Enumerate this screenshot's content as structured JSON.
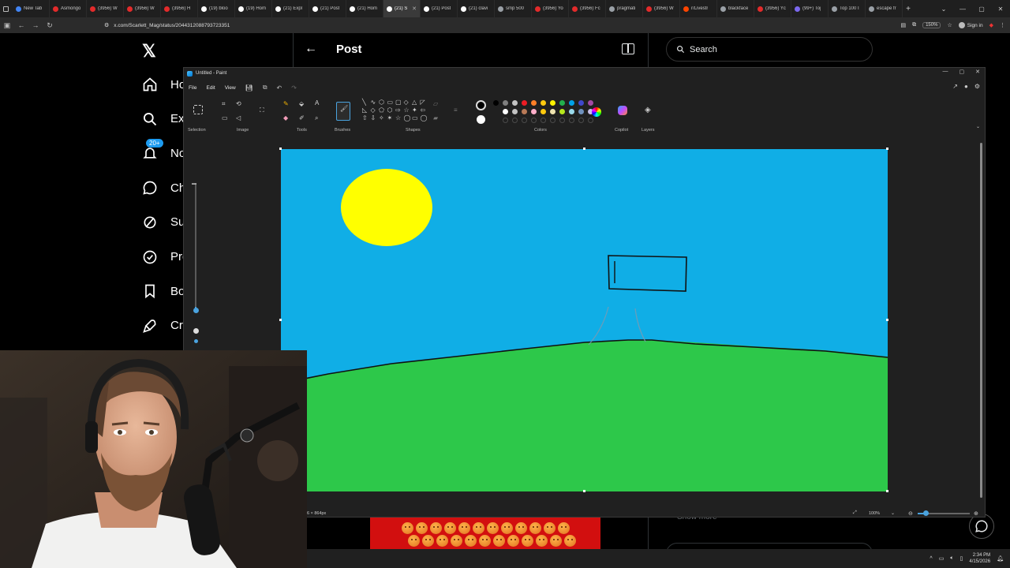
{
  "browser": {
    "tabs": [
      {
        "label": "New Tab",
        "color": "#4285f4"
      },
      {
        "label": "Asmongo",
        "color": "#e32b2b"
      },
      {
        "label": "(3956) W",
        "color": "#e32b2b"
      },
      {
        "label": "(3956) W",
        "color": "#e32b2b"
      },
      {
        "label": "(3956) H",
        "color": "#e32b2b"
      },
      {
        "label": "(19) bloo",
        "color": "#ffffff"
      },
      {
        "label": "(19) Hom",
        "color": "#ffffff"
      },
      {
        "label": "(21) Expl",
        "color": "#ffffff"
      },
      {
        "label": "(21) Post",
        "color": "#ffffff"
      },
      {
        "label": "(21) Hom",
        "color": "#ffffff"
      },
      {
        "label": "(21) S",
        "color": "#ffffff",
        "active": true
      },
      {
        "label": "(21) Post",
        "color": "#ffffff"
      },
      {
        "label": "(21) clavi",
        "color": "#ffffff"
      },
      {
        "label": "smp 500",
        "color": "#9aa0a6"
      },
      {
        "label": "(3956) Yo",
        "color": "#e32b2b"
      },
      {
        "label": "(3956) Fc",
        "color": "#e32b2b"
      },
      {
        "label": "pragmati",
        "color": "#9aa0a6"
      },
      {
        "label": "(3956) W",
        "color": "#e32b2b"
      },
      {
        "label": "r/Livestr",
        "color": "#ff4500"
      },
      {
        "label": "blackface",
        "color": "#9aa0a6"
      },
      {
        "label": "(3956) Yc",
        "color": "#e32b2b"
      },
      {
        "label": "(99+) Toj",
        "color": "#7b68ee"
      },
      {
        "label": "Top 100 I",
        "color": "#9aa0a6"
      },
      {
        "label": "escape fr",
        "color": "#9aa0a6"
      }
    ],
    "url": "x.com/Scarlett_Mag/status/2044312088793723351",
    "zoom": "150%",
    "signin_label": "Sign in"
  },
  "x": {
    "nav": [
      {
        "label": "Ho",
        "icon": "home-icon"
      },
      {
        "label": "Ex",
        "icon": "search-icon"
      },
      {
        "label": "No",
        "icon": "bell-icon",
        "badge": "20+"
      },
      {
        "label": "Ch",
        "icon": "chat-icon"
      },
      {
        "label": "Su",
        "icon": "slash-icon"
      },
      {
        "label": "Pre",
        "icon": "verified-icon"
      },
      {
        "label": "Bo",
        "icon": "bookmark-icon"
      },
      {
        "label": "Cr",
        "icon": "rocket-icon"
      }
    ],
    "header_title": "Post",
    "search_placeholder": "Search",
    "show_more": "Show more"
  },
  "paint": {
    "title": "Untitled - Paint",
    "menu": [
      "File",
      "Edit",
      "View"
    ],
    "groups": {
      "selection": "Selection",
      "image": "Image",
      "tools": "Tools",
      "brushes": "Brushes",
      "shapes": "Shapes",
      "colors": "Colors",
      "copilot": "Copilot",
      "layers": "Layers"
    },
    "palette_row1": [
      "#000000",
      "#7f7f7f",
      "#c3c3c3",
      "#ed1c24",
      "#ff7f27",
      "#ffc90e",
      "#fff200",
      "#22b14c",
      "#00a2e8",
      "#3f48cc",
      "#a349a4"
    ],
    "palette_row2": [
      "#ffffff",
      "#c3c3c3",
      "#b97a57",
      "#ffaec9",
      "#ffc90e",
      "#efe4b0",
      "#b5e61d",
      "#99d9ea",
      "#7092be",
      "#c8bfe7"
    ],
    "primary_color": "#000000",
    "secondary_color": "#ffffff",
    "canvas_colors": {
      "sky": "#10aee6",
      "grass": "#2dc84a",
      "sun": "#ffff00"
    },
    "status_dims": "6 × 864px",
    "zoom_label": "100%"
  },
  "taskbar": {
    "time": "2:34 PM",
    "date": "4/15/2026"
  }
}
